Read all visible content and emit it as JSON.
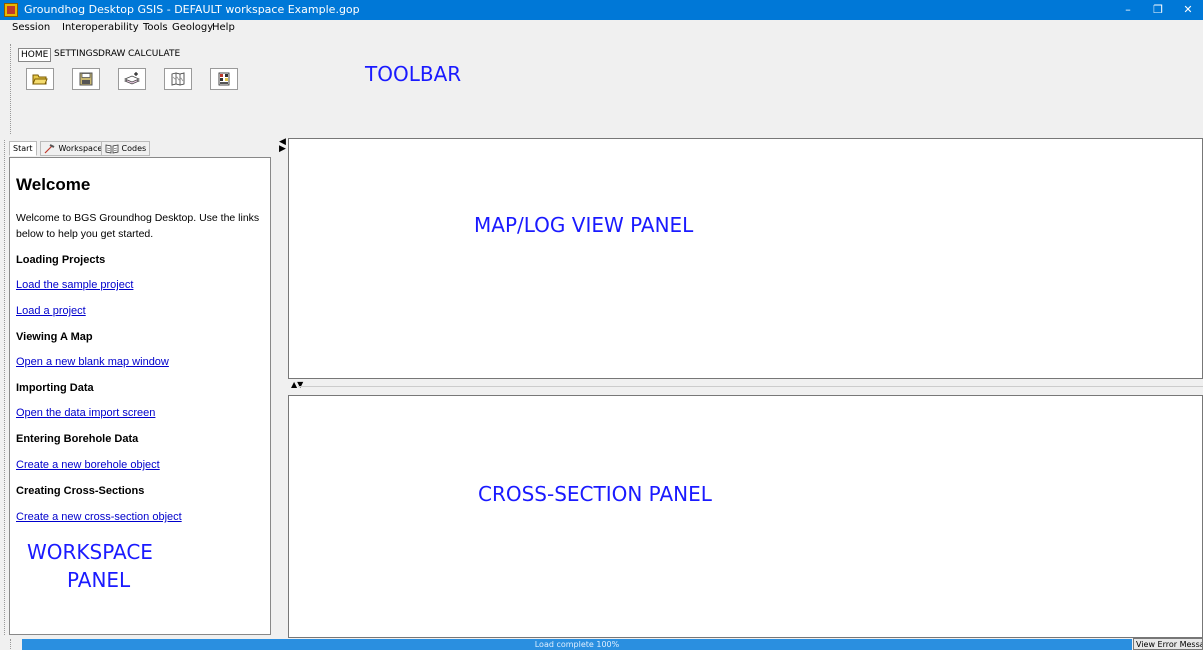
{
  "window": {
    "title": "Groundhog Desktop GSIS - DEFAULT workspace Example.gop",
    "minimize": "–",
    "restore": "❐",
    "close": "✕"
  },
  "menu": {
    "items": [
      "Session",
      "Interoperability",
      "Tools",
      "Geology",
      "Help"
    ]
  },
  "ribbon": {
    "tabs": [
      "HOME",
      "SETTINGS",
      "DRAW",
      "CALCULATE"
    ],
    "active_tab": "HOME",
    "buttons": [
      "open-folder-icon",
      "save-icon",
      "layers-add-icon",
      "map-icon",
      "log-table-icon"
    ]
  },
  "labels": {
    "toolbar": "TOOLBAR",
    "map_view": "MAP/LOG VIEW PANEL",
    "cross_section": "CROSS-SECTION PANEL",
    "workspace_line1": "WORKSPACE",
    "workspace_line2": "PANEL"
  },
  "left_tabs": {
    "start": "Start",
    "workspace": "Workspace",
    "codes": "Codes"
  },
  "start_page": {
    "heading": "Welcome",
    "intro_line1": "Welcome to BGS Groundhog Desktop. Use the links",
    "intro_line2": "below to help you get started.",
    "sections": [
      {
        "title": "Loading Projects",
        "links": [
          "Load the sample project",
          "Load a project"
        ]
      },
      {
        "title": "Viewing A Map",
        "links": [
          "Open a new blank map window"
        ]
      },
      {
        "title": "Importing Data",
        "links": [
          "Open the data import screen"
        ]
      },
      {
        "title": "Entering Borehole Data",
        "links": [
          "Create a new borehole object"
        ]
      },
      {
        "title": "Creating Cross-Sections",
        "links": [
          "Create a new cross-section object"
        ]
      }
    ]
  },
  "splitter": {
    "arrows": "▲▼"
  },
  "status": {
    "progress_text": "Load complete 100%",
    "progress_fraction": 1.0,
    "error_button": "View Error Messages"
  },
  "colors": {
    "titlebar": "#0078d7",
    "overlay_text": "#1a1aff",
    "link": "#0000cc",
    "progress": "#2a8fe0"
  }
}
